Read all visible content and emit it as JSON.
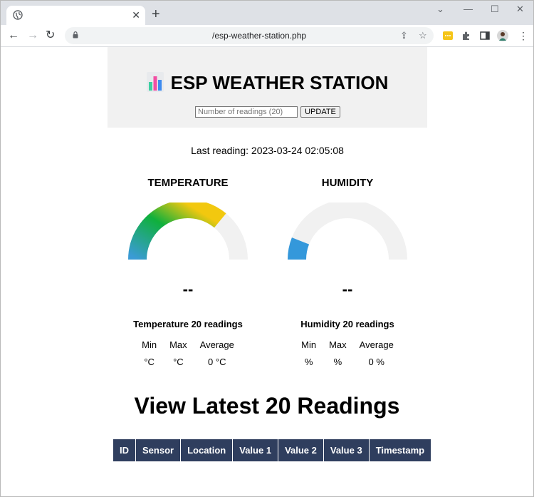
{
  "browser": {
    "tab_title": "",
    "url": "/esp-weather-station.php",
    "profile_avatar": "avatar"
  },
  "header": {
    "title": "ESP WEATHER STATION",
    "icon": "bar-chart-icon",
    "readings_placeholder": "Number of readings (20)",
    "update_label": "UPDATE"
  },
  "last_reading": "Last reading: 2023-03-24 02:05:08",
  "gauges": {
    "temperature": {
      "title": "TEMPERATURE",
      "value": "--",
      "fill_fraction": 0.72
    },
    "humidity": {
      "title": "HUMIDITY",
      "value": "--",
      "fill_fraction": 0.12
    }
  },
  "stats": {
    "temperature": {
      "title": "Temperature 20 readings",
      "headers": [
        "Min",
        "Max",
        "Average"
      ],
      "values": [
        "°C",
        "°C",
        "0 °C"
      ]
    },
    "humidity": {
      "title": "Humidity 20 readings",
      "headers": [
        "Min",
        "Max",
        "Average"
      ],
      "values": [
        "%",
        "%",
        "0 %"
      ]
    }
  },
  "latest_title": "View Latest 20 Readings",
  "readings_table": {
    "columns": [
      "ID",
      "Sensor",
      "Location",
      "Value 1",
      "Value 2",
      "Value 3",
      "Timestamp"
    ]
  },
  "colors": {
    "header_bg": "#f1f1f1",
    "table_header": "#2f3e5e",
    "gauge_track": "#f1f1f1",
    "humidity_fill": "#3498db"
  }
}
